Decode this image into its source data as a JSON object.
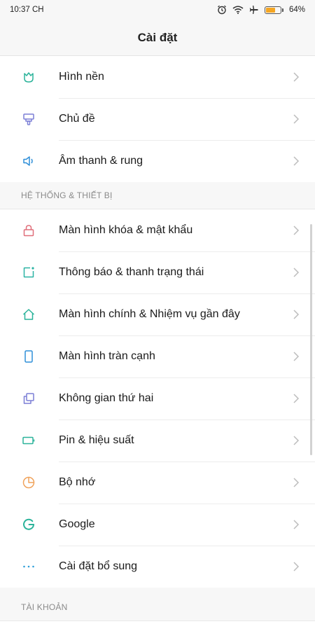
{
  "status_bar": {
    "time": "10:37 CH",
    "battery_percent": "64%",
    "battery_level": 0.64,
    "icons": [
      "alarm-icon",
      "wifi-icon",
      "airplane-icon",
      "battery-icon"
    ]
  },
  "header": {
    "title": "Cài đặt"
  },
  "personal": {
    "items": [
      {
        "label": "Hình nền",
        "icon": "wallpaper-icon",
        "color": "#2bb39a"
      },
      {
        "label": "Chủ đề",
        "icon": "theme-brush-icon",
        "color": "#7b7fd6"
      },
      {
        "label": "Âm thanh & rung",
        "icon": "speaker-icon",
        "color": "#2f8fd8"
      }
    ]
  },
  "system": {
    "header": "HỆ THỐNG & THIẾT BỊ",
    "items": [
      {
        "label": "Màn hình khóa & mật khẩu",
        "icon": "lock-icon",
        "color": "#e06f7a"
      },
      {
        "label": "Thông báo & thanh trạng thái",
        "icon": "notification-icon",
        "color": "#2bb3a4"
      },
      {
        "label": "Màn hình chính & Nhiệm vụ gần đây",
        "icon": "home-icon",
        "color": "#2bb39a"
      },
      {
        "label": "Màn hình tràn cạnh",
        "icon": "phone-screen-icon",
        "color": "#2f8fd8"
      },
      {
        "label": "Không gian thứ hai",
        "icon": "second-space-icon",
        "color": "#7b7fd6"
      },
      {
        "label": "Pin & hiệu suất",
        "icon": "battery-settings-icon",
        "color": "#2bb39a"
      },
      {
        "label": "Bộ nhớ",
        "icon": "storage-pie-icon",
        "color": "#f0a35c"
      },
      {
        "label": "Google",
        "icon": "google-icon",
        "color": "#2bb39a"
      },
      {
        "label": "Cài đặt bổ sung",
        "icon": "more-dots-icon",
        "color": "#2f9fd8"
      }
    ]
  },
  "accounts": {
    "header": "TÀI KHOẢN"
  }
}
